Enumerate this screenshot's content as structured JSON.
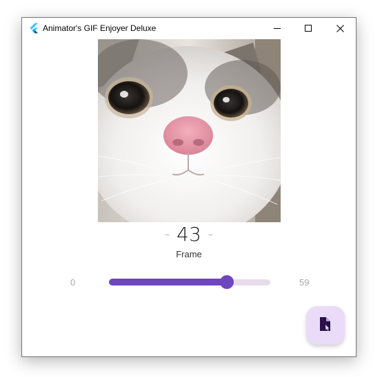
{
  "window": {
    "title": "Animator's GIF Enjoyer Deluxe"
  },
  "icons": {
    "app": "flutter-logo-icon",
    "minimize": "minimize-icon",
    "maximize": "maximize-icon",
    "close": "close-icon",
    "fab": "open-file-icon"
  },
  "image": {
    "subject": "cat-face-closeup"
  },
  "frame": {
    "dash_left": "-",
    "current": "43",
    "dash_right": "-",
    "label": "Frame"
  },
  "slider": {
    "min": "0",
    "max": "59",
    "value": 43
  },
  "colors": {
    "accent": "#6f45c0",
    "track": "#e7dcea",
    "fab_bg": "#eadcf8",
    "fab_icon": "#2a1147"
  }
}
